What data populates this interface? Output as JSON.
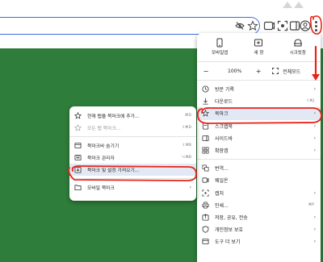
{
  "toolbar": {
    "icons": [
      "eye-off-icon",
      "star-icon",
      "extension-icon",
      "screenshot-icon",
      "sidebar-icon",
      "profile-icon",
      "menu-icon"
    ]
  },
  "main_menu": {
    "top_items": [
      {
        "label": "모바일앱",
        "icon": "mobile-icon"
      },
      {
        "label": "새 창",
        "icon": "new-window-icon"
      },
      {
        "label": "시크릿창",
        "icon": "incognito-icon"
      }
    ],
    "zoom": {
      "minus": "−",
      "value": "100%",
      "plus": "+",
      "fullscreen_label": "전체모드"
    },
    "items": [
      {
        "label": "방문 기록",
        "shortcut": "",
        "arrow": "›",
        "icon": "history-icon"
      },
      {
        "label": "다운로드",
        "shortcut": "⇧⌘J",
        "arrow": "",
        "icon": "download-icon"
      },
      {
        "label": "북마크",
        "shortcut": "",
        "arrow": "›",
        "icon": "star-icon"
      },
      {
        "label": "스크랩북",
        "shortcut": "",
        "arrow": "›",
        "icon": "scrapbook-icon"
      },
      {
        "label": "사이드바",
        "shortcut": "",
        "arrow": "›",
        "icon": "sidebar-icon"
      },
      {
        "label": "확장앱",
        "shortcut": "",
        "arrow": "›",
        "icon": "extension-icon"
      },
      {
        "label": "번역...",
        "shortcut": "",
        "arrow": "",
        "icon": "translate-icon"
      },
      {
        "label": "웨일온",
        "shortcut": "",
        "arrow": "",
        "icon": "whale-on-icon"
      },
      {
        "label": "캡처",
        "shortcut": "",
        "arrow": "›",
        "icon": "capture-icon"
      },
      {
        "label": "인쇄...",
        "shortcut": "⌘P",
        "arrow": "",
        "icon": "print-icon"
      },
      {
        "label": "저장, 공유, 전송",
        "shortcut": "",
        "arrow": "›",
        "icon": "share-icon"
      },
      {
        "label": "개인정보 보호",
        "shortcut": "",
        "arrow": "›",
        "icon": "privacy-icon"
      },
      {
        "label": "도구 더 보기",
        "shortcut": "",
        "arrow": "›",
        "icon": "tools-icon"
      }
    ]
  },
  "bookmark_menu": {
    "items": [
      {
        "label": "현재 탭을 북마크에 추가...",
        "shortcut": "⌘D",
        "icon": "star-icon"
      },
      {
        "label": "모든 탭 북마크...",
        "shortcut": "⇧⌘D",
        "icon": "star-icon"
      },
      {
        "label": "북마크바 숨기기",
        "shortcut": "⇧⌘B",
        "icon": "bookmark-bar-icon"
      },
      {
        "label": "북마크 관리자",
        "shortcut": "⌥⌘B",
        "icon": "bookmark-manager-icon"
      },
      {
        "label": "북마크 및 설정 가져오기...",
        "shortcut": "",
        "icon": "import-icon"
      },
      {
        "label": "모바일 북마크",
        "shortcut": "",
        "arrow": "›",
        "icon": "folder-icon"
      }
    ]
  },
  "colors": {
    "page_background": "#2e7d3a",
    "annotation": "#e8231a",
    "highlight": "#e3e9f4",
    "omnibox_border": "#3a6fd8"
  }
}
